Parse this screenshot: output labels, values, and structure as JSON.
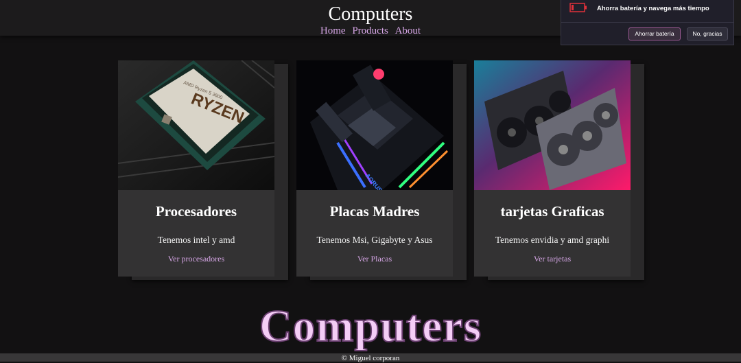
{
  "header": {
    "title": "Computers",
    "nav": [
      "Home",
      "Products",
      "About"
    ]
  },
  "cards": [
    {
      "title": "Procesadores",
      "text": "Tenemos intel y amd",
      "link": "Ver procesadores",
      "image_label": "AMD RYZEN"
    },
    {
      "title": "Placas Madres",
      "text": "Tenemos Msi, Gigabyte y Asus",
      "link": "Ver Placas"
    },
    {
      "title": "tarjetas Graficas",
      "text": "Tenemos envidia y amd graphi",
      "link": "Ver tarjetas"
    }
  ],
  "big_title": "Computers",
  "footer": "© Miguel corporan",
  "notification": {
    "message": "Ahorra batería y navega más tiempo",
    "primary": "Ahorrar batería",
    "secondary": "No, gracias"
  },
  "colors": {
    "background": "#121112",
    "card": "#333233",
    "link": "#d6a6e6",
    "big_title": "#f4cdf6"
  }
}
